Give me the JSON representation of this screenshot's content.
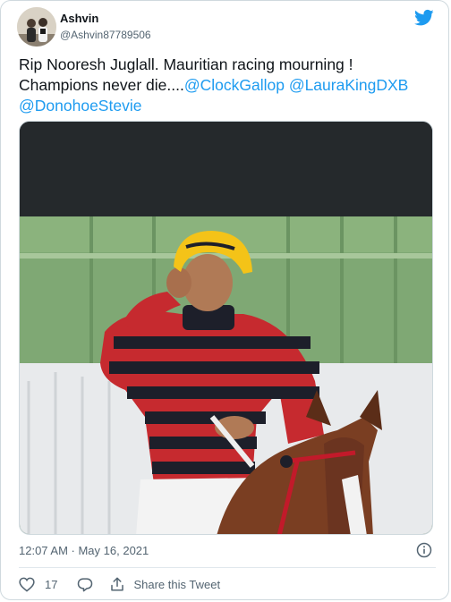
{
  "tweet": {
    "author_name": "Ashvin",
    "author_handle": "@Ashvin87789506",
    "text_line1": "Rip Nooresh Juglall. Mauritian racing mourning !",
    "text_line2": "Champions never die....",
    "mentions": [
      "@ClockGallop",
      "@LauraKingDXB",
      "@DonohoeStevie"
    ],
    "timestamp": "12:07 AM · May 16, 2021",
    "like_count": "17",
    "share_label": "Share this Tweet"
  },
  "icons": {
    "brand": "twitter-bird-icon",
    "info": "info-icon",
    "like": "heart-icon",
    "reply": "reply-icon",
    "share": "share-icon"
  },
  "colors": {
    "accent": "#1d9bf0",
    "text": "#0f1419",
    "secondary": "#536471",
    "border": "#cfd9de"
  }
}
